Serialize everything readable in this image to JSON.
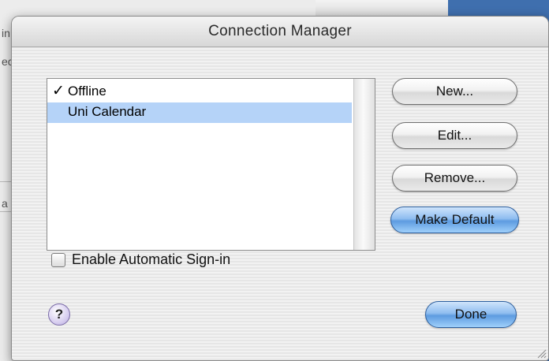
{
  "background": {
    "glyphs": [
      "in",
      "ec",
      "a c"
    ]
  },
  "dialog": {
    "title": "Connection Manager"
  },
  "connections": {
    "items": [
      {
        "label": "Offline",
        "checked": true,
        "selected": false
      },
      {
        "label": "Uni Calendar",
        "checked": false,
        "selected": true
      }
    ],
    "check_glyph": "✓"
  },
  "buttons": {
    "new": "New...",
    "edit": "Edit...",
    "remove": "Remove...",
    "make_default": "Make Default",
    "done": "Done"
  },
  "options": {
    "auto_signin_label": "Enable Automatic Sign-in",
    "auto_signin_checked": false
  },
  "help": {
    "glyph": "?"
  },
  "colors": {
    "selection": "#b5d3f8",
    "default_button": "#5d9be0",
    "desktop": "#3f6fae"
  }
}
